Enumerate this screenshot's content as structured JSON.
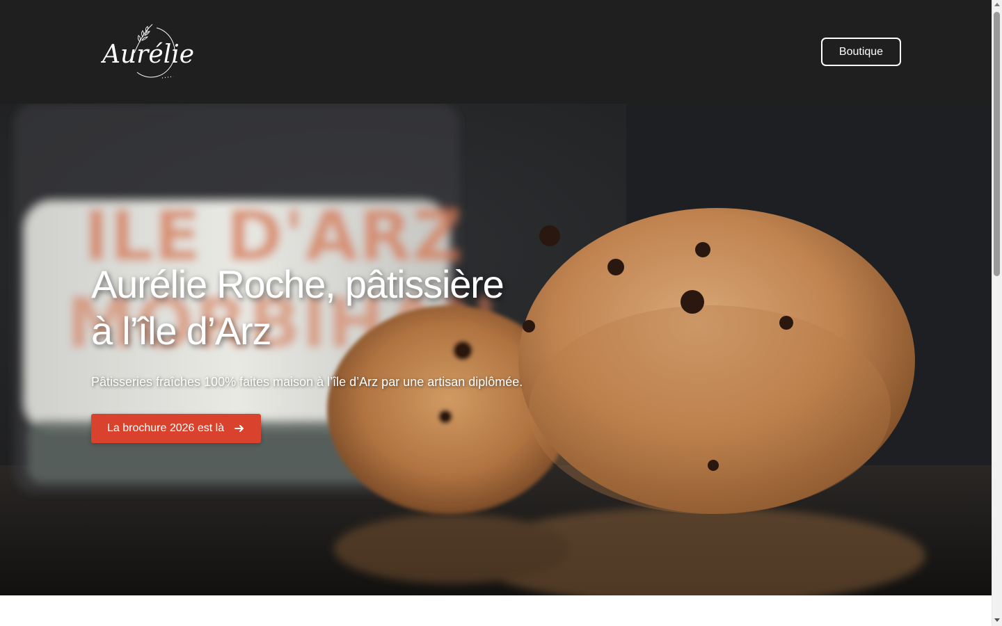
{
  "header": {
    "logo_text": "Aurélie",
    "shop_button_label": "Boutique"
  },
  "hero": {
    "title_line1": "Aurélie Roche, pâtissière",
    "title_line2": "à l’île d’Arz",
    "subtitle": "Pâtisseries fraîches 100% faites maison à l’île d’Arz par une artisan diplômée.",
    "cta_label": "La brochure 2026 est là",
    "cta_icon": "arrow-right-icon",
    "image_subject": "cookies-and-milk-photo"
  },
  "colors": {
    "header_bg": "#1f1f1f",
    "cta_bg": "#d9432d",
    "text_light": "#ffffff"
  }
}
